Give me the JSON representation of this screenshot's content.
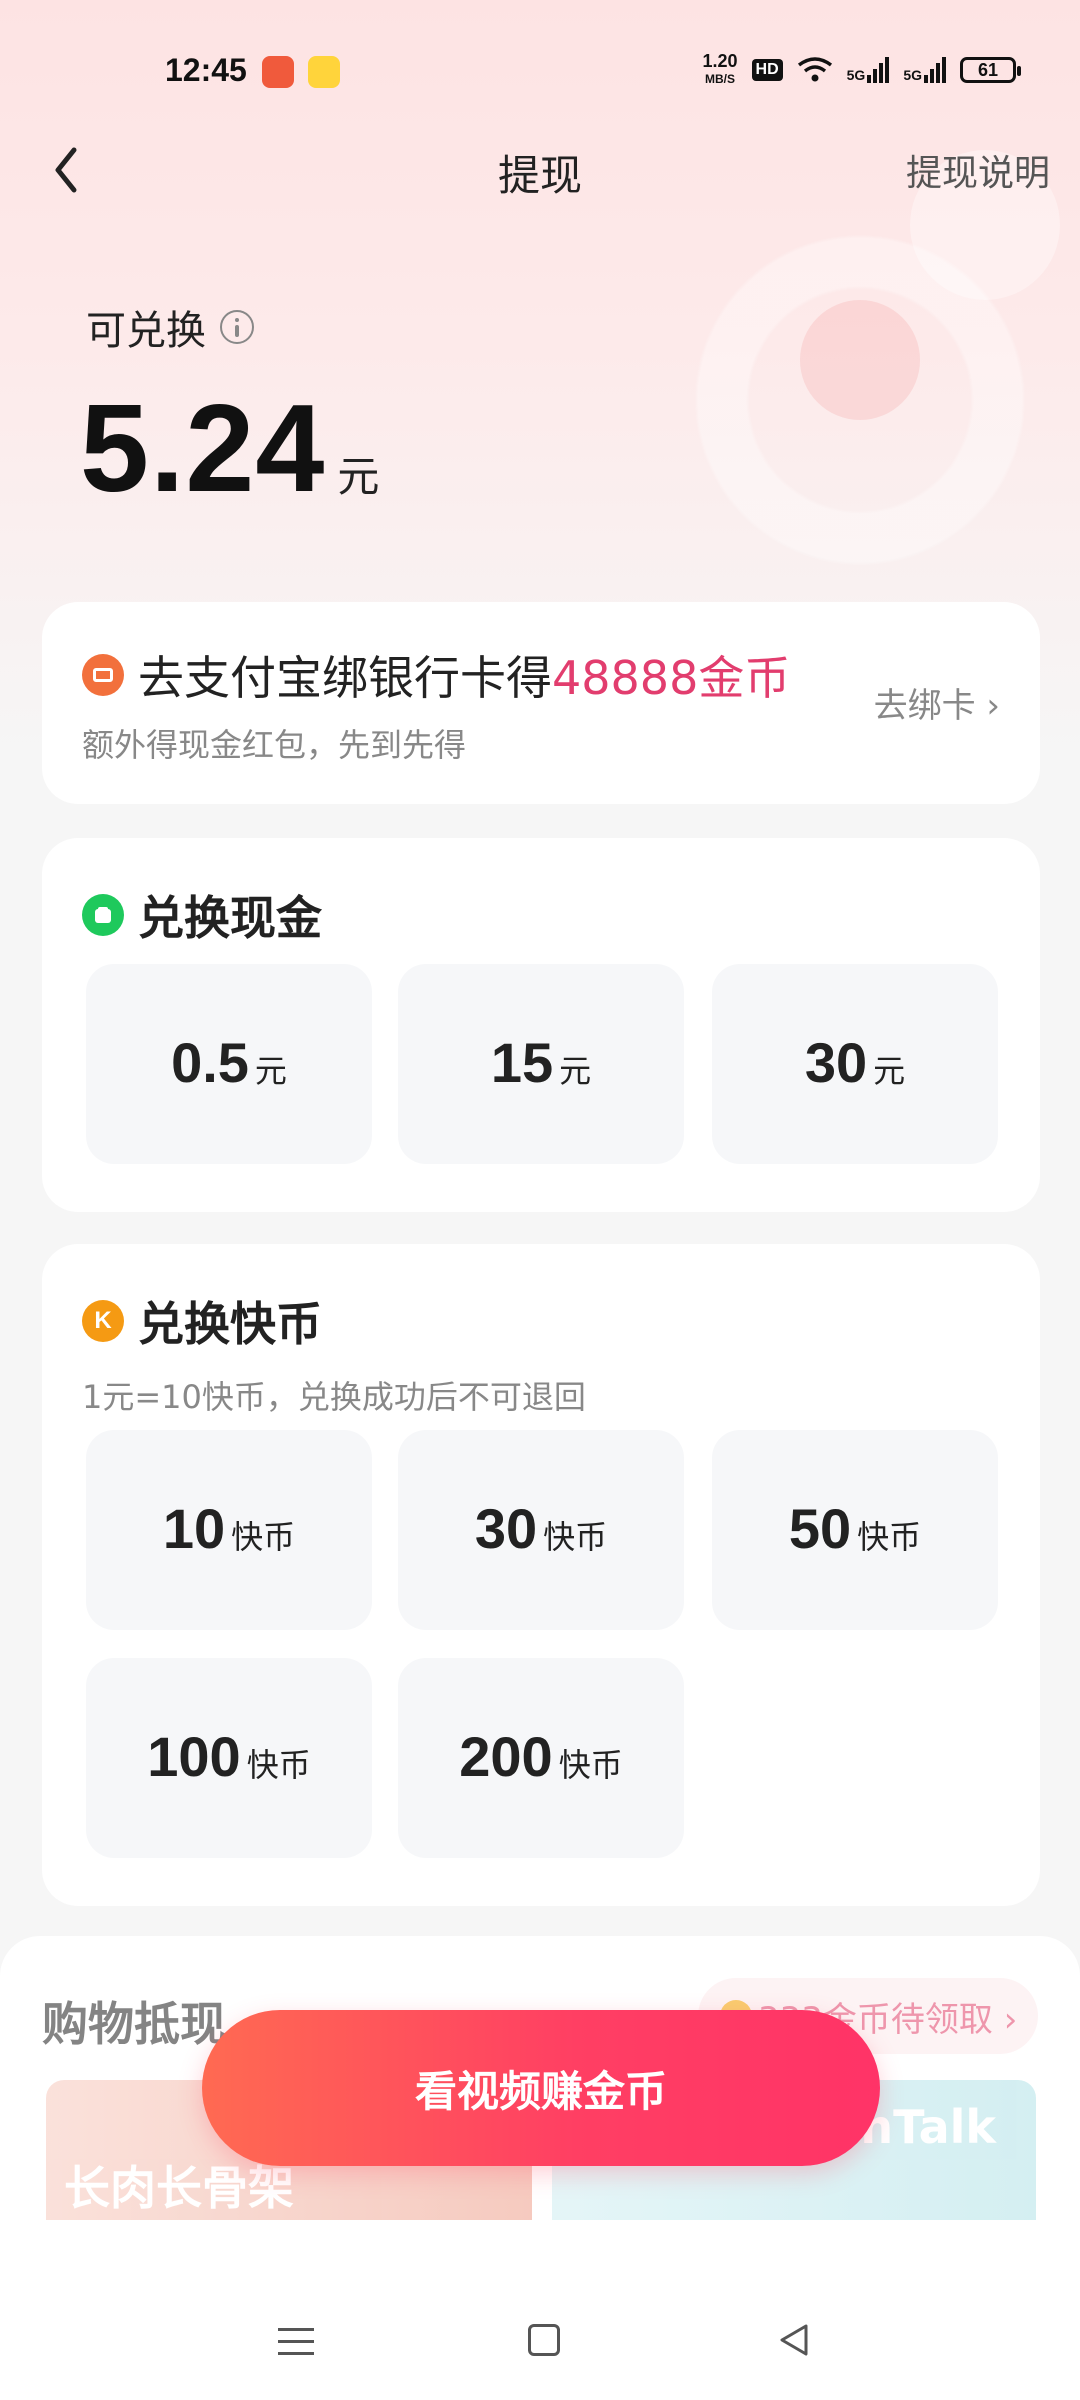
{
  "status_bar": {
    "time": "12:45",
    "speed_top": "1.20",
    "speed_bottom": "MB/S",
    "hd": "HD",
    "net1": "5G",
    "net2": "5G",
    "battery": "61"
  },
  "header": {
    "title": "提现",
    "right_link": "提现说明"
  },
  "balance": {
    "label": "可兑换",
    "amount": "5.24",
    "unit": "元"
  },
  "alipay_promo": {
    "title_prefix": "去支付宝绑银行卡得",
    "title_highlight": "48888金币",
    "subtitle": "额外得现金红包，先到先得",
    "action": "去绑卡 ›"
  },
  "cash_section": {
    "title": "兑换现金",
    "options": [
      {
        "value": "0.5",
        "unit": "元"
      },
      {
        "value": "15",
        "unit": "元"
      },
      {
        "value": "30",
        "unit": "元"
      }
    ]
  },
  "kuaibi_section": {
    "icon_letter": "K",
    "title": "兑换快币",
    "subtitle": "1元=10快币，兑换成功后不可退回",
    "options": [
      {
        "value": "10",
        "unit": "快币"
      },
      {
        "value": "30",
        "unit": "快币"
      },
      {
        "value": "50",
        "unit": "快币"
      },
      {
        "value": "100",
        "unit": "快币"
      },
      {
        "value": "200",
        "unit": "快币"
      }
    ]
  },
  "shopping": {
    "title": "购物抵现",
    "pill": "333金币待领取 ›",
    "left_banner": "长肉长骨架",
    "right_banner": "nTalk"
  },
  "cta": {
    "label": "看视频赚金币"
  },
  "colors": {
    "accent": "#e23d6e",
    "cta_start": "#ff6a52",
    "cta_end": "#ff3367",
    "cash_icon": "#1ec95c",
    "kuaibi_icon": "#f59a13"
  }
}
